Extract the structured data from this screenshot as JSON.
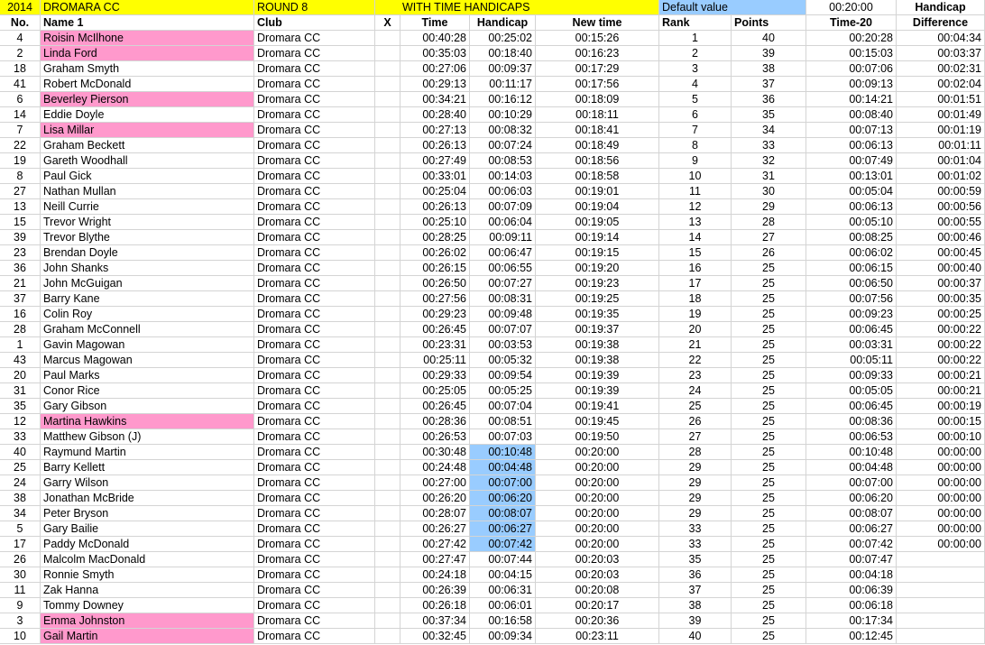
{
  "title": {
    "year": "2014",
    "club": "DROMARA CC",
    "round": "ROUND 8",
    "note": "WITH TIME HANDICAPS",
    "default_label": "Default value",
    "default_value": "00:20:00",
    "handicap_label": "Handicap"
  },
  "headers": [
    "No.",
    "Name 1",
    "Club",
    "X",
    "Time",
    "Handicap",
    "New time",
    "Rank",
    "Points",
    "Time-20",
    "Difference"
  ],
  "colors": {
    "title_bg": "#ffff00",
    "default_bg": "#99ccff",
    "female_bg": "#ff99cc",
    "handicap_bg": "#99ccff"
  },
  "rows": [
    {
      "no": "4",
      "name": "Roisin McIlhone",
      "club": "Dromara CC",
      "time": "00:40:28",
      "handicap": "00:25:02",
      "new_time": "00:15:26",
      "rank": "1",
      "points": "40",
      "time20": "00:20:28",
      "diff": "00:04:34",
      "female": true,
      "hl": false
    },
    {
      "no": "2",
      "name": "Linda Ford",
      "club": "Dromara CC",
      "time": "00:35:03",
      "handicap": "00:18:40",
      "new_time": "00:16:23",
      "rank": "2",
      "points": "39",
      "time20": "00:15:03",
      "diff": "00:03:37",
      "female": true,
      "hl": false
    },
    {
      "no": "18",
      "name": "Graham Smyth",
      "club": "Dromara CC",
      "time": "00:27:06",
      "handicap": "00:09:37",
      "new_time": "00:17:29",
      "rank": "3",
      "points": "38",
      "time20": "00:07:06",
      "diff": "00:02:31",
      "female": false,
      "hl": false
    },
    {
      "no": "41",
      "name": "Robert McDonald",
      "club": "Dromara CC",
      "time": "00:29:13",
      "handicap": "00:11:17",
      "new_time": "00:17:56",
      "rank": "4",
      "points": "37",
      "time20": "00:09:13",
      "diff": "00:02:04",
      "female": false,
      "hl": false
    },
    {
      "no": "6",
      "name": "Beverley Pierson",
      "club": "Dromara CC",
      "time": "00:34:21",
      "handicap": "00:16:12",
      "new_time": "00:18:09",
      "rank": "5",
      "points": "36",
      "time20": "00:14:21",
      "diff": "00:01:51",
      "female": true,
      "hl": false
    },
    {
      "no": "14",
      "name": "Eddie Doyle",
      "club": "Dromara CC",
      "time": "00:28:40",
      "handicap": "00:10:29",
      "new_time": "00:18:11",
      "rank": "6",
      "points": "35",
      "time20": "00:08:40",
      "diff": "00:01:49",
      "female": false,
      "hl": false
    },
    {
      "no": "7",
      "name": "Lisa Millar",
      "club": "Dromara CC",
      "time": "00:27:13",
      "handicap": "00:08:32",
      "new_time": "00:18:41",
      "rank": "7",
      "points": "34",
      "time20": "00:07:13",
      "diff": "00:01:19",
      "female": true,
      "hl": false
    },
    {
      "no": "22",
      "name": "Graham Beckett",
      "club": "Dromara CC",
      "time": "00:26:13",
      "handicap": "00:07:24",
      "new_time": "00:18:49",
      "rank": "8",
      "points": "33",
      "time20": "00:06:13",
      "diff": "00:01:11",
      "female": false,
      "hl": false
    },
    {
      "no": "19",
      "name": "Gareth Woodhall",
      "club": "Dromara CC",
      "time": "00:27:49",
      "handicap": "00:08:53",
      "new_time": "00:18:56",
      "rank": "9",
      "points": "32",
      "time20": "00:07:49",
      "diff": "00:01:04",
      "female": false,
      "hl": false
    },
    {
      "no": "8",
      "name": "Paul Gick",
      "club": "Dromara CC",
      "time": "00:33:01",
      "handicap": "00:14:03",
      "new_time": "00:18:58",
      "rank": "10",
      "points": "31",
      "time20": "00:13:01",
      "diff": "00:01:02",
      "female": false,
      "hl": false
    },
    {
      "no": "27",
      "name": "Nathan Mullan",
      "club": "Dromara CC",
      "time": "00:25:04",
      "handicap": "00:06:03",
      "new_time": "00:19:01",
      "rank": "11",
      "points": "30",
      "time20": "00:05:04",
      "diff": "00:00:59",
      "female": false,
      "hl": false
    },
    {
      "no": "13",
      "name": "Neill Currie",
      "club": "Dromara CC",
      "time": "00:26:13",
      "handicap": "00:07:09",
      "new_time": "00:19:04",
      "rank": "12",
      "points": "29",
      "time20": "00:06:13",
      "diff": "00:00:56",
      "female": false,
      "hl": false
    },
    {
      "no": "15",
      "name": "Trevor Wright",
      "club": "Dromara CC",
      "time": "00:25:10",
      "handicap": "00:06:04",
      "new_time": "00:19:05",
      "rank": "13",
      "points": "28",
      "time20": "00:05:10",
      "diff": "00:00:55",
      "female": false,
      "hl": false
    },
    {
      "no": "39",
      "name": "Trevor Blythe",
      "club": "Dromara CC",
      "time": "00:28:25",
      "handicap": "00:09:11",
      "new_time": "00:19:14",
      "rank": "14",
      "points": "27",
      "time20": "00:08:25",
      "diff": "00:00:46",
      "female": false,
      "hl": false
    },
    {
      "no": "23",
      "name": "Brendan Doyle",
      "club": "Dromara CC",
      "time": "00:26:02",
      "handicap": "00:06:47",
      "new_time": "00:19:15",
      "rank": "15",
      "points": "26",
      "time20": "00:06:02",
      "diff": "00:00:45",
      "female": false,
      "hl": false
    },
    {
      "no": "36",
      "name": "John Shanks",
      "club": "Dromara CC",
      "time": "00:26:15",
      "handicap": "00:06:55",
      "new_time": "00:19:20",
      "rank": "16",
      "points": "25",
      "time20": "00:06:15",
      "diff": "00:00:40",
      "female": false,
      "hl": false
    },
    {
      "no": "21",
      "name": "John McGuigan",
      "club": "Dromara CC",
      "time": "00:26:50",
      "handicap": "00:07:27",
      "new_time": "00:19:23",
      "rank": "17",
      "points": "25",
      "time20": "00:06:50",
      "diff": "00:00:37",
      "female": false,
      "hl": false
    },
    {
      "no": "37",
      "name": "Barry Kane",
      "club": "Dromara CC",
      "time": "00:27:56",
      "handicap": "00:08:31",
      "new_time": "00:19:25",
      "rank": "18",
      "points": "25",
      "time20": "00:07:56",
      "diff": "00:00:35",
      "female": false,
      "hl": false
    },
    {
      "no": "16",
      "name": "Colin Roy",
      "club": "Dromara CC",
      "time": "00:29:23",
      "handicap": "00:09:48",
      "new_time": "00:19:35",
      "rank": "19",
      "points": "25",
      "time20": "00:09:23",
      "diff": "00:00:25",
      "female": false,
      "hl": false
    },
    {
      "no": "28",
      "name": "Graham McConnell",
      "club": "Dromara CC",
      "time": "00:26:45",
      "handicap": "00:07:07",
      "new_time": "00:19:37",
      "rank": "20",
      "points": "25",
      "time20": "00:06:45",
      "diff": "00:00:22",
      "female": false,
      "hl": false
    },
    {
      "no": "1",
      "name": "Gavin Magowan",
      "club": "Dromara CC",
      "time": "00:23:31",
      "handicap": "00:03:53",
      "new_time": "00:19:38",
      "rank": "21",
      "points": "25",
      "time20": "00:03:31",
      "diff": "00:00:22",
      "female": false,
      "hl": false
    },
    {
      "no": "43",
      "name": "Marcus Magowan",
      "club": "Dromara CC",
      "time": "00:25:11",
      "handicap": "00:05:32",
      "new_time": "00:19:38",
      "rank": "22",
      "points": "25",
      "time20": "00:05:11",
      "diff": "00:00:22",
      "female": false,
      "hl": false
    },
    {
      "no": "20",
      "name": "Paul Marks",
      "club": "Dromara CC",
      "time": "00:29:33",
      "handicap": "00:09:54",
      "new_time": "00:19:39",
      "rank": "23",
      "points": "25",
      "time20": "00:09:33",
      "diff": "00:00:21",
      "female": false,
      "hl": false
    },
    {
      "no": "31",
      "name": "Conor Rice",
      "club": "Dromara CC",
      "time": "00:25:05",
      "handicap": "00:05:25",
      "new_time": "00:19:39",
      "rank": "24",
      "points": "25",
      "time20": "00:05:05",
      "diff": "00:00:21",
      "female": false,
      "hl": false
    },
    {
      "no": "35",
      "name": "Gary Gibson",
      "club": "Dromara CC",
      "time": "00:26:45",
      "handicap": "00:07:04",
      "new_time": "00:19:41",
      "rank": "25",
      "points": "25",
      "time20": "00:06:45",
      "diff": "00:00:19",
      "female": false,
      "hl": false
    },
    {
      "no": "12",
      "name": "Martina Hawkins",
      "club": "Dromara CC",
      "time": "00:28:36",
      "handicap": "00:08:51",
      "new_time": "00:19:45",
      "rank": "26",
      "points": "25",
      "time20": "00:08:36",
      "diff": "00:00:15",
      "female": true,
      "hl": false
    },
    {
      "no": "33",
      "name": "Matthew Gibson (J)",
      "club": "Dromara CC",
      "time": "00:26:53",
      "handicap": "00:07:03",
      "new_time": "00:19:50",
      "rank": "27",
      "points": "25",
      "time20": "00:06:53",
      "diff": "00:00:10",
      "female": false,
      "hl": false
    },
    {
      "no": "40",
      "name": "Raymund Martin",
      "club": "Dromara CC",
      "time": "00:30:48",
      "handicap": "00:10:48",
      "new_time": "00:20:00",
      "rank": "28",
      "points": "25",
      "time20": "00:10:48",
      "diff": "00:00:00",
      "female": false,
      "hl": true
    },
    {
      "no": "25",
      "name": "Barry Kellett",
      "club": "Dromara CC",
      "time": "00:24:48",
      "handicap": "00:04:48",
      "new_time": "00:20:00",
      "rank": "29",
      "points": "25",
      "time20": "00:04:48",
      "diff": "00:00:00",
      "female": false,
      "hl": true
    },
    {
      "no": "24",
      "name": "Garry Wilson",
      "club": "Dromara CC",
      "time": "00:27:00",
      "handicap": "00:07:00",
      "new_time": "00:20:00",
      "rank": "29",
      "points": "25",
      "time20": "00:07:00",
      "diff": "00:00:00",
      "female": false,
      "hl": true
    },
    {
      "no": "38",
      "name": "Jonathan McBride",
      "club": "Dromara CC",
      "time": "00:26:20",
      "handicap": "00:06:20",
      "new_time": "00:20:00",
      "rank": "29",
      "points": "25",
      "time20": "00:06:20",
      "diff": "00:00:00",
      "female": false,
      "hl": true
    },
    {
      "no": "34",
      "name": "Peter Bryson",
      "club": "Dromara CC",
      "time": "00:28:07",
      "handicap": "00:08:07",
      "new_time": "00:20:00",
      "rank": "29",
      "points": "25",
      "time20": "00:08:07",
      "diff": "00:00:00",
      "female": false,
      "hl": true
    },
    {
      "no": "5",
      "name": "Gary Bailie",
      "club": "Dromara CC",
      "time": "00:26:27",
      "handicap": "00:06:27",
      "new_time": "00:20:00",
      "rank": "33",
      "points": "25",
      "time20": "00:06:27",
      "diff": "00:00:00",
      "female": false,
      "hl": true
    },
    {
      "no": "17",
      "name": "Paddy McDonald",
      "club": "Dromara CC",
      "time": "00:27:42",
      "handicap": "00:07:42",
      "new_time": "00:20:00",
      "rank": "33",
      "points": "25",
      "time20": "00:07:42",
      "diff": "00:00:00",
      "female": false,
      "hl": true
    },
    {
      "no": "26",
      "name": "Malcolm MacDonald",
      "club": "Dromara CC",
      "time": "00:27:47",
      "handicap": "00:07:44",
      "new_time": "00:20:03",
      "rank": "35",
      "points": "25",
      "time20": "00:07:47",
      "diff": "",
      "female": false,
      "hl": false
    },
    {
      "no": "30",
      "name": "Ronnie Smyth",
      "club": "Dromara CC",
      "time": "00:24:18",
      "handicap": "00:04:15",
      "new_time": "00:20:03",
      "rank": "36",
      "points": "25",
      "time20": "00:04:18",
      "diff": "",
      "female": false,
      "hl": false
    },
    {
      "no": "11",
      "name": "Zak Hanna",
      "club": "Dromara CC",
      "time": "00:26:39",
      "handicap": "00:06:31",
      "new_time": "00:20:08",
      "rank": "37",
      "points": "25",
      "time20": "00:06:39",
      "diff": "",
      "female": false,
      "hl": false
    },
    {
      "no": "9",
      "name": "Tommy Downey",
      "club": "Dromara CC",
      "time": "00:26:18",
      "handicap": "00:06:01",
      "new_time": "00:20:17",
      "rank": "38",
      "points": "25",
      "time20": "00:06:18",
      "diff": "",
      "female": false,
      "hl": false
    },
    {
      "no": "3",
      "name": "Emma Johnston",
      "club": "Dromara CC",
      "time": "00:37:34",
      "handicap": "00:16:58",
      "new_time": "00:20:36",
      "rank": "39",
      "points": "25",
      "time20": "00:17:34",
      "diff": "",
      "female": true,
      "hl": false
    },
    {
      "no": "10",
      "name": "Gail Martin",
      "club": "Dromara CC",
      "time": "00:32:45",
      "handicap": "00:09:34",
      "new_time": "00:23:11",
      "rank": "40",
      "points": "25",
      "time20": "00:12:45",
      "diff": "",
      "female": true,
      "hl": false
    }
  ]
}
